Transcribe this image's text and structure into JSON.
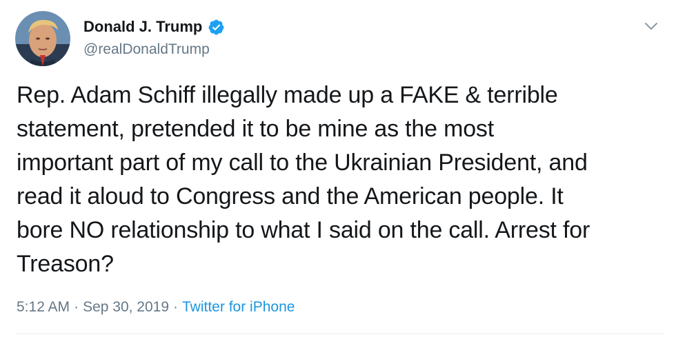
{
  "user": {
    "display_name": "Donald J. Trump",
    "handle": "@realDonaldTrump",
    "verified": true,
    "avatar_icon": "profile-photo"
  },
  "tweet": {
    "lines": [
      "Rep. Adam Schiff illegally made up a FAKE & terrible",
      "statement, pretended it to be mine as the most",
      "important part of my call to the Ukrainian President, and",
      "read it aloud to Congress and the American people. It",
      "bore NO relationship to what I said on the call. Arrest for",
      "Treason?"
    ]
  },
  "meta": {
    "time": "5:12 AM",
    "separator": "·",
    "date": "Sep 30, 2019",
    "source": "Twitter for iPhone"
  },
  "icons": {
    "verified": "verified-badge-icon",
    "menu": "chevron-down-icon"
  },
  "colors": {
    "verified": "#1da1f2",
    "link": "#1b95e0",
    "secondary_text": "#657786",
    "primary_text": "#14171a"
  }
}
